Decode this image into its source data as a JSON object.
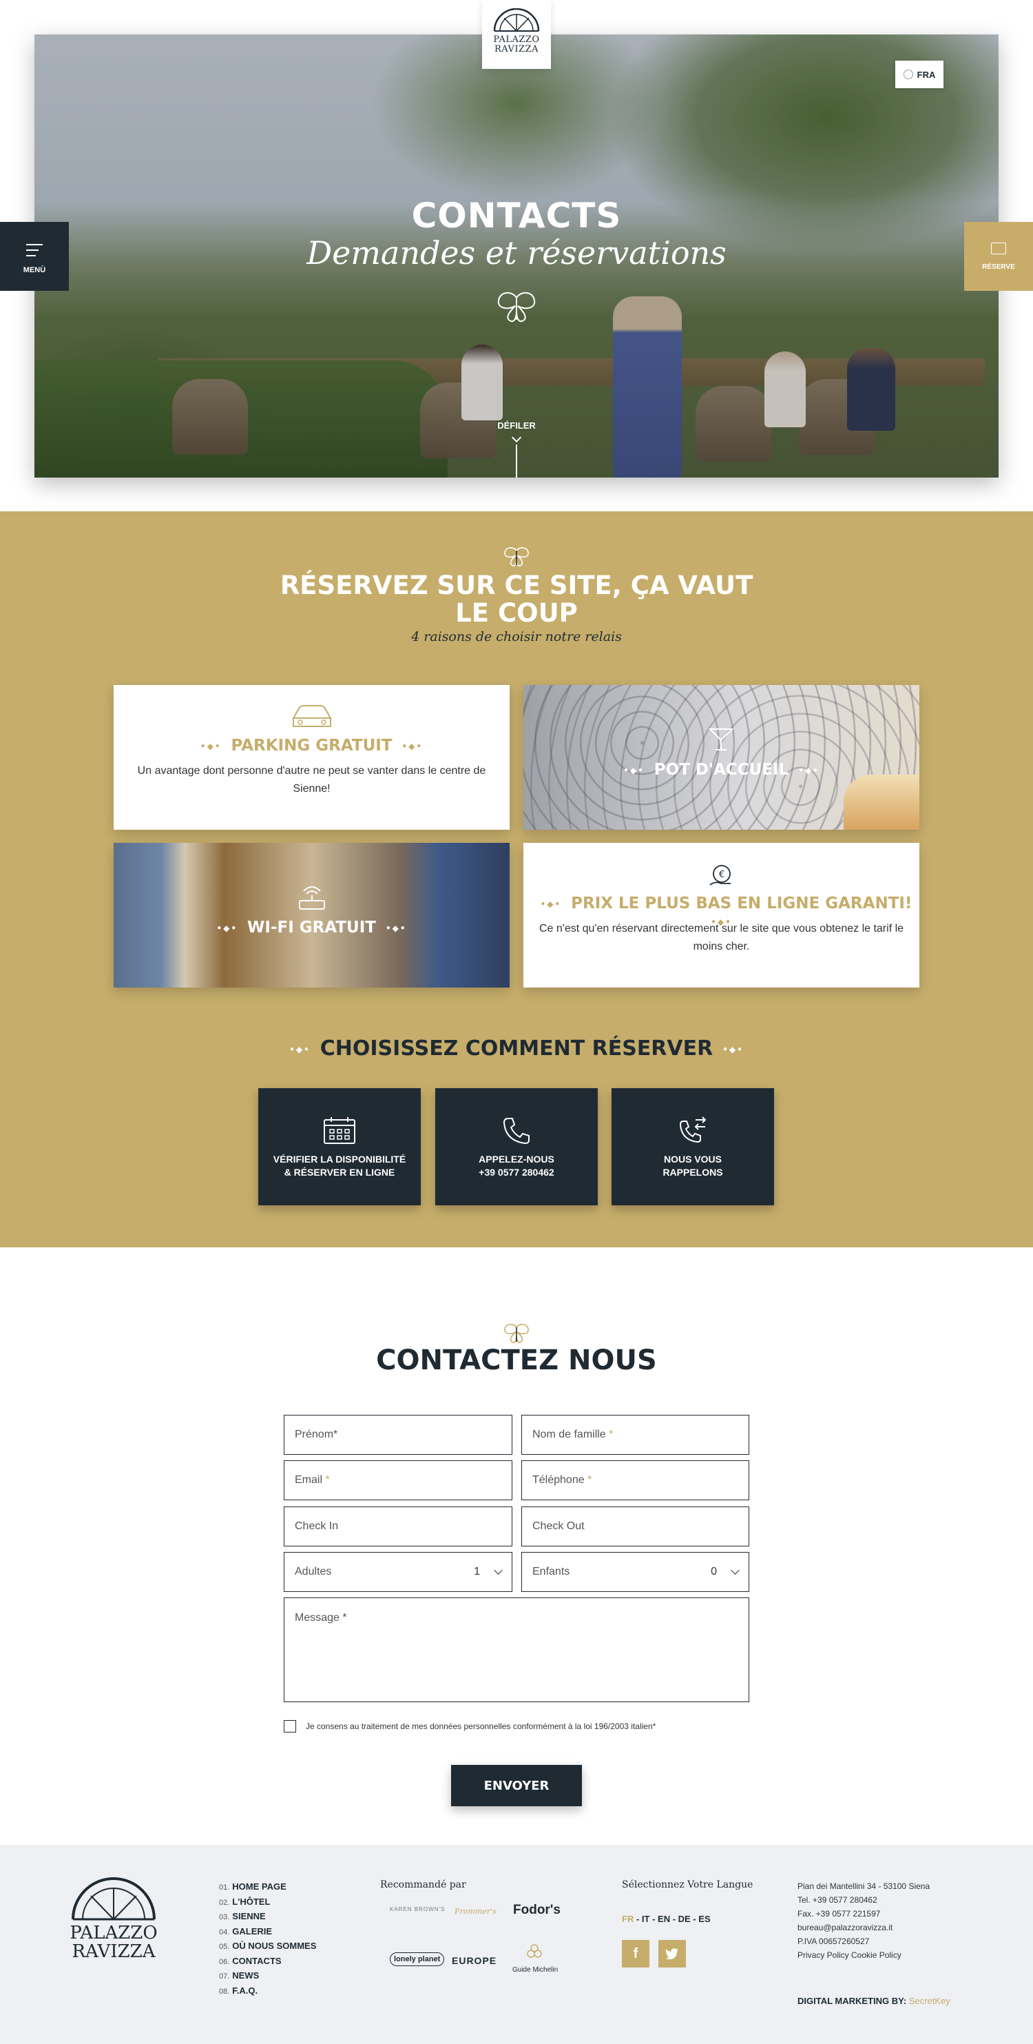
{
  "brand": {
    "line1": "PALAZZO",
    "line2": "RAVIZZA"
  },
  "header": {
    "language": "FRA",
    "menu_label": "MENÙ",
    "book_label": "RÉSERVE"
  },
  "hero": {
    "title": "CONTACTS",
    "subtitle": "Demandes et réservations",
    "scroll_label": "DÉFILER"
  },
  "reasons": {
    "title": "RÉSERVEZ SUR CE SITE, ÇA VAUT LE COUP",
    "subtitle": "4 raisons de choisir notre relais",
    "cards": [
      {
        "title": "PARKING GRATUIT",
        "text": "Un avantage dont personne d'autre ne peut se vanter dans le centre de Sienne!"
      },
      {
        "title": "POT D'ACCUEIL"
      },
      {
        "title": "WI-FI GRATUIT"
      },
      {
        "title": "PRIX LE PLUS BAS EN LIGNE GARANTI!",
        "text": "Ce n'est qu'en réservant directement sur le site que vous obtenez le tarif le moins cher."
      }
    ]
  },
  "booking": {
    "title": "CHOISISSEZ COMMENT RÉSERVER",
    "options": [
      {
        "line1": "VÉRIFIER LA DISPONIBILITÉ",
        "line2": "& RÉSERVER EN LIGNE"
      },
      {
        "line1": "APPELEZ-NOUS",
        "line2": "+39 0577 280462"
      },
      {
        "line1": "NOUS VOUS",
        "line2": "RAPPELONS"
      }
    ]
  },
  "contact": {
    "title": "CONTACTEZ NOUS",
    "fields": {
      "first_name": "Prénom",
      "last_name": "Nom de famille",
      "email": "Email",
      "phone": "Téléphone",
      "check_in": "Check In",
      "check_out": "Check Out",
      "adults": "Adultes",
      "adults_value": "1",
      "children": "Enfants",
      "children_value": "0",
      "message": "Message"
    },
    "required_mark": "*",
    "consent": "Je consens au traitement de mes données personnelles conformément à la loi 196/2003 italien*",
    "submit": "ENVOYER"
  },
  "footer": {
    "menu": [
      {
        "num": "01.",
        "label": "HOME PAGE"
      },
      {
        "num": "02.",
        "label": "L'HÔTEL"
      },
      {
        "num": "03.",
        "label": "SIENNE"
      },
      {
        "num": "04.",
        "label": "GALERIE"
      },
      {
        "num": "05.",
        "label": "OÙ NOUS SOMMES"
      },
      {
        "num": "06.",
        "label": "CONTACTS"
      },
      {
        "num": "07.",
        "label": "NEWS"
      },
      {
        "num": "08.",
        "label": "F.A.Q."
      }
    ],
    "recommended_title": "Recommandé par",
    "press": [
      "KAREN BROWN'S",
      "Frommer's",
      "Fodor's",
      "lonely planet",
      "EUROPE",
      "Guide Michelin"
    ],
    "language_title": "Sélectionnez Votre Langue",
    "languages": [
      "FR",
      "IT",
      "EN",
      "DE",
      "ES"
    ],
    "address": "Pian dei Mantellini 34 - 53100 Siena",
    "tel": "Tel. +39 0577 280462",
    "fax": "Fax. +39 0577 221597",
    "email": "bureau@palazzoravizza.it",
    "vat": "P.IVA 00657260527",
    "policies": "Privacy Policy Cookie Policy",
    "credit_label": "DIGITAL MARKETING BY:",
    "credit_name": "SecretKey",
    "colors": {
      "gold": "#c6ad6b",
      "navy": "#1f2a33",
      "footer_bg": "#eef0f3"
    }
  }
}
